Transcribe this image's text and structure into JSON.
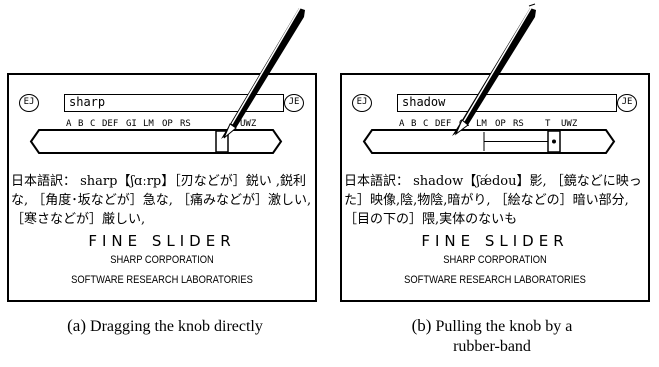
{
  "panels": [
    {
      "dict_left": "EJ",
      "dict_right": "JE",
      "word": "sharp",
      "index_labels": [
        "A",
        "B",
        "C",
        "DEF",
        "GI",
        "LM",
        "OP",
        "RS",
        "UWZ"
      ],
      "translation": "日本語訳： sharp【ʃɑːrp】［刃などが］鋭い ,鋭利な, ［角度･坂などが］急な, ［痛みなどが］激しい, ［寒さなどが］厳しい,",
      "brand_title": "FINE SLIDER",
      "brand_corp": "SHARP CORPORATION",
      "brand_lab": "SOFTWARE RESEARCH LABORATORIES",
      "caption_tag": "(a)",
      "caption": "Dragging the knob directly"
    },
    {
      "dict_left": "EJ",
      "dict_right": "JE",
      "word": "shadow",
      "index_labels": [
        "A",
        "B",
        "C",
        "DEF",
        "GI",
        "LM",
        "OP",
        "RS",
        "T",
        "UWZ"
      ],
      "translation": "日本語訳： shadow【ʃǽdou】影, ［鏡などに映った］映像,陰,物陰,暗がり, ［絵などの］暗い部分, ［目の下の］隈,実体のないも",
      "brand_title": "FINE SLIDER",
      "brand_corp": "SHARP CORPORATION",
      "brand_lab": "SOFTWARE RESEARCH LABORATORIES",
      "caption_tag": "(b)",
      "caption": "Pulling the knob by a rubber-band"
    }
  ]
}
